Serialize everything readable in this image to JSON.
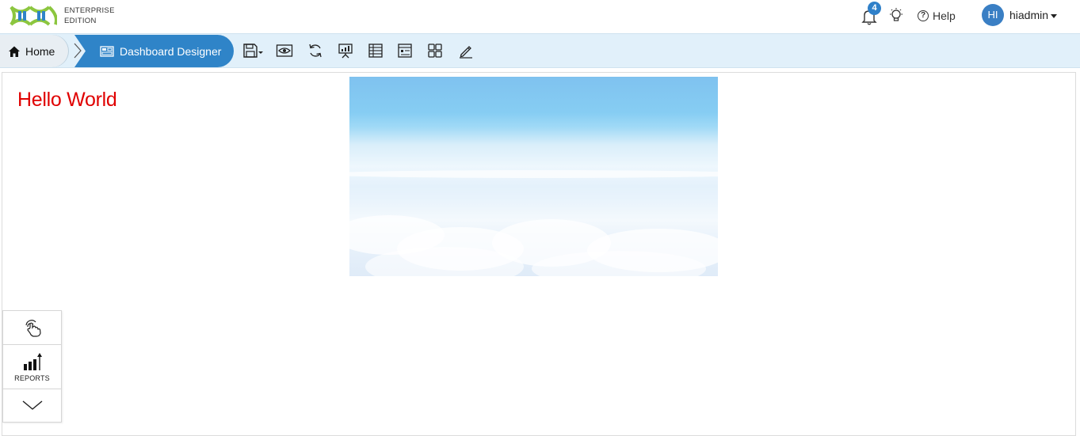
{
  "app": {
    "edition_line1": "ENTERPRISE",
    "edition_line2": "EDITION",
    "brand_colors": {
      "logo_green": "#8cc63f",
      "logo_blue": "#2f84c8"
    }
  },
  "header": {
    "notification_count": "4",
    "help_label": "Help",
    "user_initials": "HI",
    "username": "hiadmin"
  },
  "breadcrumb": {
    "home_label": "Home",
    "current_label": "Dashboard Designer"
  },
  "toolbar": {
    "icons": [
      "save-icon",
      "preview-icon",
      "refresh-icon",
      "presentation-icon",
      "table-icon",
      "layout-icon",
      "grid-icon",
      "edit-icon"
    ]
  },
  "canvas": {
    "heading_text": "Hello World",
    "heading_color": "#e00000",
    "image_subject": "sky above clouds"
  },
  "side_panel": {
    "reports_label": "REPORTS"
  }
}
